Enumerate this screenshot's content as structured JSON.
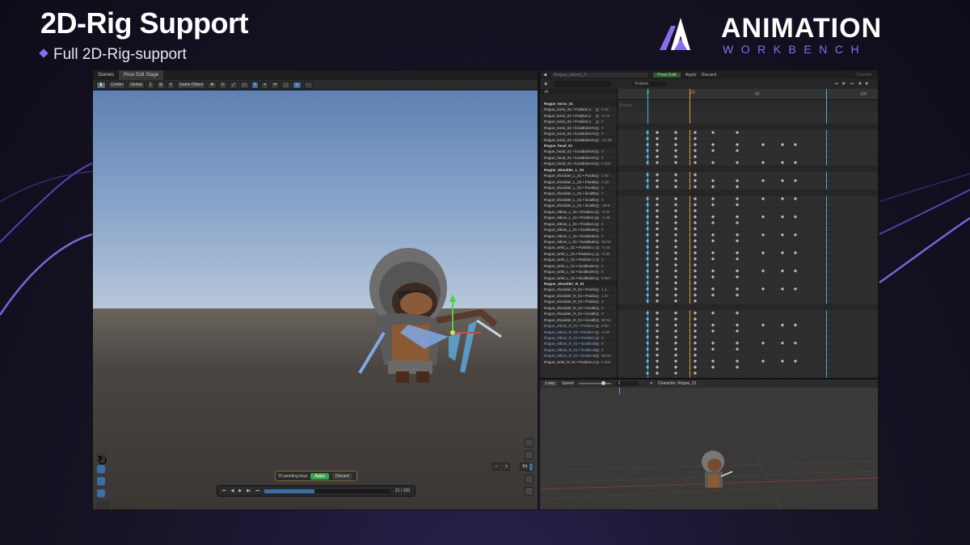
{
  "slide": {
    "title": "2D-Rig Support",
    "subtitle": "Full 2D-Rig-support",
    "accent": "#8b6cf0"
  },
  "logo": {
    "name": "ANIMATION",
    "sub": "WORKBENCH"
  },
  "scene_view": {
    "tabs": [
      "Scenes",
      "Pose Edit Stage"
    ],
    "toolbar": {
      "pivot": "Center",
      "space": "Global",
      "layer": "1",
      "camera": "Game Object"
    },
    "pose_bar": {
      "status": "10 pending keys",
      "apply": "Apply",
      "discard": "Discard"
    },
    "timeline": {
      "frame_readout": "21 / 100",
      "progress": 0.4
    },
    "zoom": [
      "−",
      "+",
      "Fit"
    ]
  },
  "animation_window": {
    "clip": "Rogue_attack_2",
    "pose_edit": "Pose Edit",
    "apply": "Apply",
    "discard": "Discard",
    "commit": "Commit",
    "unit": "Frames",
    "filter": "All",
    "events_label": "Events",
    "ruler": {
      "start": "0",
      "playhead": "20",
      "mid": "60",
      "end": "100"
    },
    "tracks": [
      {
        "label": "Rogue_torso_01",
        "group": true
      },
      {
        "label": "Rogue_torso_01 • Position.x",
        "value": "0.22"
      },
      {
        "label": "Rogue_torso_01 • Position.y",
        "value": "-0.74"
      },
      {
        "label": "Rogue_torso_01 • Position.z",
        "value": "0"
      },
      {
        "label": "Rogue_torso_01 • localEulerAn",
        "value": "0"
      },
      {
        "label": "Rogue_torso_01 • localEulerAn",
        "value": "0"
      },
      {
        "label": "Rogue_torso_01 • localEulerAn",
        "value": "-11.08"
      },
      {
        "label": "Rogue_head_01",
        "group": true
      },
      {
        "label": "Rogue_head_01 • localEulerAn",
        "value": "0"
      },
      {
        "label": "Rogue_head_01 • localEulerAn",
        "value": "0"
      },
      {
        "label": "Rogue_head_01 • localEulerAn",
        "value": "0.202"
      },
      {
        "label": "Rogue_shoulder_L_01",
        "group": true
      },
      {
        "label": "Rogue_shoulder_L_01 • Positio",
        "value": "1.62"
      },
      {
        "label": "Rogue_shoulder_L_01 • Positio",
        "value": "2.18"
      },
      {
        "label": "Rogue_shoulder_L_01 • Positio",
        "value": "0"
      },
      {
        "label": "Rogue_shoulder_L_01 • localEu",
        "value": "0"
      },
      {
        "label": "Rogue_shoulder_L_01 • localEu",
        "value": "0"
      },
      {
        "label": "Rogue_shoulder_L_01 • localEu",
        "value": "-39.5"
      },
      {
        "label": "Rogue_elbow_L_01 • Position.x",
        "value": "-0.44"
      },
      {
        "label": "Rogue_elbow_L_01 • Position.y",
        "value": "-1.49"
      },
      {
        "label": "Rogue_elbow_L_01 • Position.z",
        "value": "0"
      },
      {
        "label": "Rogue_elbow_L_01 • localEuler",
        "value": "0"
      },
      {
        "label": "Rogue_elbow_L_01 • localEuler",
        "value": "0"
      },
      {
        "label": "Rogue_elbow_L_01 • localEuler",
        "value": "45.09"
      },
      {
        "label": "Rogue_wrist_L_01 • Position.x",
        "value": "-0.46"
      },
      {
        "label": "Rogue_wrist_L_01 • Position.y",
        "value": "-0.39"
      },
      {
        "label": "Rogue_wrist_L_01 • Position.z",
        "value": "0"
      },
      {
        "label": "Rogue_wrist_L_01 • localEulerA",
        "value": "0"
      },
      {
        "label": "Rogue_wrist_L_01 • localEulerA",
        "value": "0"
      },
      {
        "label": "Rogue_wrist_L_01 • localEulerA",
        "value": "9.957"
      },
      {
        "label": "Rogue_shoulder_R_01",
        "group": true
      },
      {
        "label": "Rogue_shoulder_R_01 • Positio",
        "value": "1.4"
      },
      {
        "label": "Rogue_shoulder_R_01 • Positio",
        "value": "1.27"
      },
      {
        "label": "Rogue_shoulder_R_01 • Positio",
        "value": "0"
      },
      {
        "label": "Rogue_shoulder_R_01 • localEu",
        "value": "0"
      },
      {
        "label": "Rogue_shoulder_R_01 • localEu",
        "value": "0"
      },
      {
        "label": "Rogue_shoulder_R_01 • localEu",
        "value": "50.53"
      },
      {
        "label": "Rogue_elbow_R_01 • Position.x",
        "value": "0.52",
        "sel": true
      },
      {
        "label": "Rogue_elbow_R_01 • Position.y",
        "value": "-1.62",
        "sel": true
      },
      {
        "label": "Rogue_elbow_R_01 • Position.z",
        "value": "0",
        "sel": true
      },
      {
        "label": "Rogue_elbow_R_01 • localEuler",
        "value": "0",
        "sel": true
      },
      {
        "label": "Rogue_elbow_R_01 • localEuler",
        "value": "0",
        "sel": true
      },
      {
        "label": "Rogue_elbow_R_01 • localEuler",
        "value": "58.33",
        "sel": true
      },
      {
        "label": "Rogue_wrist_R_01 • Position.x",
        "value": "0.202"
      }
    ]
  },
  "preview": {
    "loop": "Loop",
    "speed_label": "Speed",
    "speed_value": "1",
    "character": "Character: Rogue_01"
  }
}
